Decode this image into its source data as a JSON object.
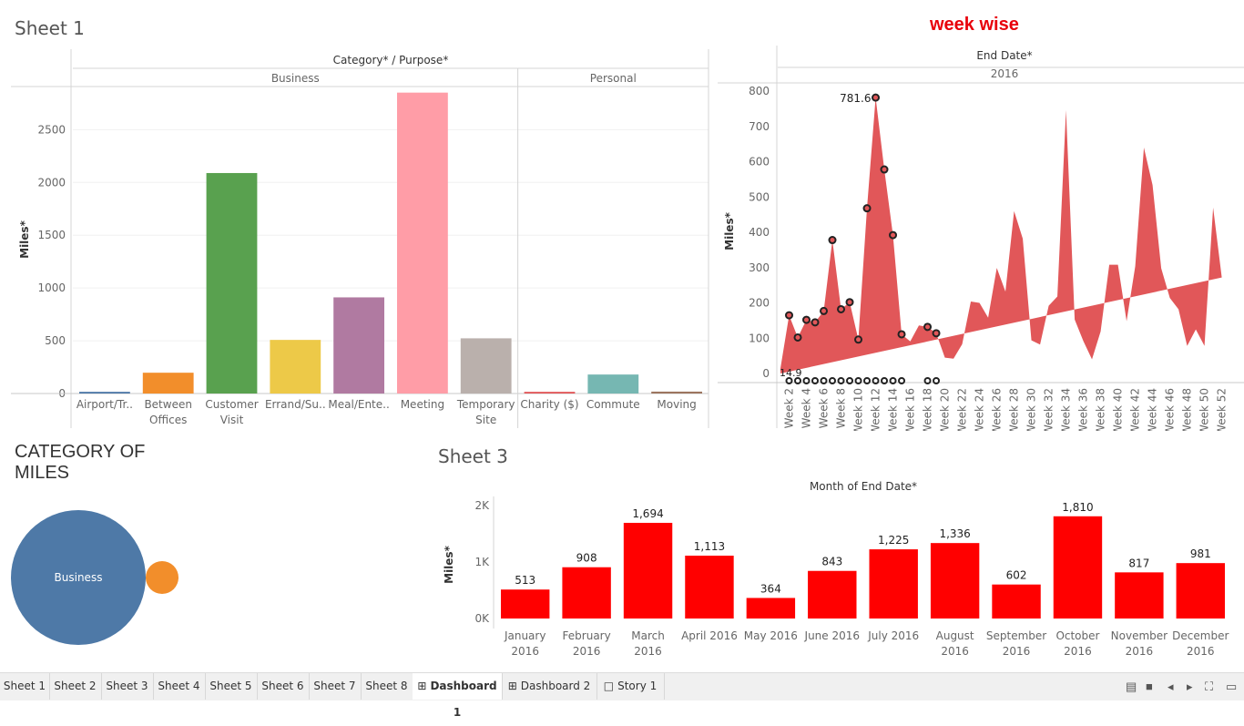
{
  "sheet1": {
    "title": "Sheet 1",
    "chart_data": {
      "type": "bar",
      "header": "Category* / Purpose*",
      "groups": [
        "Business",
        "Personal"
      ],
      "ylabel": "Miles*",
      "ylim": [
        0,
        2900
      ],
      "yticks": [
        0,
        500,
        1000,
        1500,
        2000,
        2500
      ],
      "ytick_labels": [
        "0",
        "500",
        "1000",
        "1500",
        "2000",
        "2500"
      ],
      "categories": [
        {
          "label": [
            "Airport/Tr.."
          ],
          "group": "Business",
          "value": 16,
          "color": "#4e79a7"
        },
        {
          "label": [
            "Between",
            "Offices"
          ],
          "group": "Business",
          "value": 197,
          "color": "#f28e2b"
        },
        {
          "label": [
            "Customer",
            "Visit"
          ],
          "group": "Business",
          "value": 2089,
          "color": "#59a14f"
        },
        {
          "label": [
            "Errand/Su.."
          ],
          "group": "Business",
          "value": 508,
          "color": "#edc948"
        },
        {
          "label": [
            "Meal/Ente.."
          ],
          "group": "Business",
          "value": 911,
          "color": "#b07aa1"
        },
        {
          "label": [
            "Meeting"
          ],
          "group": "Business",
          "value": 2851,
          "color": "#ff9da7"
        },
        {
          "label": [
            "Temporary",
            "Site"
          ],
          "group": "Business",
          "value": 523,
          "color": "#bab0ac"
        },
        {
          "label": [
            "Charity ($)"
          ],
          "group": "Personal",
          "value": 16,
          "color": "#e15759"
        },
        {
          "label": [
            "Commute"
          ],
          "group": "Personal",
          "value": 180,
          "color": "#76b7b2"
        },
        {
          "label": [
            "Moving"
          ],
          "group": "Personal",
          "value": 18,
          "color": "#9c755f"
        }
      ]
    }
  },
  "weekwise": {
    "title": "week wise",
    "chart_data": {
      "type": "area",
      "header": "End Date*",
      "subheader": "2016",
      "ylabel": "Miles*",
      "ylim": [
        0,
        800
      ],
      "yticks": [
        0,
        100,
        200,
        300,
        400,
        500,
        600,
        700,
        800
      ],
      "ytick_labels": [
        "0",
        "100",
        "200",
        "300",
        "400",
        "500",
        "600",
        "700",
        "800"
      ],
      "x_labels": [
        "Week 2",
        "Week 4",
        "Week 6",
        "Week 8",
        "Week 10",
        "Week 12",
        "Week 14",
        "Week 16",
        "Week 18",
        "Week 20",
        "Week 22",
        "Week 24",
        "Week 26",
        "Week 28",
        "Week 30",
        "Week 32",
        "Week 34",
        "Week 36",
        "Week 38",
        "Week 40",
        "Week 42",
        "Week 44",
        "Week 46",
        "Week 48",
        "Week 50",
        "Week 52"
      ],
      "weeks": [
        1,
        2,
        3,
        4,
        5,
        6,
        7,
        8,
        9,
        10,
        11,
        12,
        13,
        14,
        15,
        16,
        17,
        18,
        19,
        20,
        21,
        22,
        23,
        24,
        25,
        26,
        27,
        28,
        29,
        30,
        31,
        32,
        33,
        34,
        35,
        36,
        37,
        38,
        39,
        40,
        41,
        42,
        43,
        44,
        45,
        46,
        47,
        48,
        49,
        50,
        51,
        52,
        53
      ],
      "values": [
        15,
        165,
        102,
        152,
        145,
        177,
        378,
        182,
        202,
        96,
        468,
        781.6,
        578,
        392,
        111,
        91,
        136,
        132,
        114,
        45,
        42,
        83,
        204,
        200,
        158,
        299,
        232,
        460,
        382,
        94,
        82,
        192,
        218,
        746,
        153,
        92,
        40,
        119,
        308,
        308,
        148,
        304,
        640,
        534,
        298,
        214,
        182,
        78,
        125,
        78,
        470,
        272
      ],
      "marked_weeks": [
        2,
        3,
        4,
        5,
        6,
        7,
        8,
        9,
        10,
        11,
        12,
        13,
        14,
        15,
        18,
        19
      ],
      "annotations": [
        {
          "text": "781.6"
        },
        {
          "text": "14.9"
        }
      ],
      "color": "#e15759"
    }
  },
  "category_of_miles": {
    "title": "CATEGORY OF MILES",
    "title_lines": [
      "CATEGORY OF",
      "MILES"
    ],
    "chart_data": {
      "type": "bubble",
      "items": [
        {
          "label": "Business",
          "color": "#4e79a7"
        },
        {
          "label": "",
          "color": "#f28e2b"
        }
      ]
    }
  },
  "sheet3": {
    "title": "Sheet 3",
    "chart_data": {
      "type": "bar",
      "header": "Month of End Date*",
      "ylabel": "Miles*",
      "ylim": [
        0,
        2000
      ],
      "yticks": [
        0,
        1000,
        2000
      ],
      "ytick_labels": [
        "0K",
        "1K",
        "2K"
      ],
      "categories": [
        [
          "January",
          "2016"
        ],
        [
          "February",
          "2016"
        ],
        [
          "March",
          "2016"
        ],
        [
          "April 2016"
        ],
        [
          "May 2016"
        ],
        [
          "June 2016"
        ],
        [
          "July 2016"
        ],
        [
          "August",
          "2016"
        ],
        [
          "September",
          "2016"
        ],
        [
          "October",
          "2016"
        ],
        [
          "November",
          "2016"
        ],
        [
          "December",
          "2016"
        ]
      ],
      "values": [
        513,
        908,
        1694,
        1113,
        364,
        843,
        1225,
        1336,
        602,
        1810,
        817,
        981
      ],
      "value_labels": [
        "513",
        "908",
        "1,694",
        "1,113",
        "364",
        "843",
        "1,225",
        "1,336",
        "602",
        "1,810",
        "817",
        "981"
      ],
      "color": "#ff0000"
    }
  },
  "tabs": [
    {
      "label": "Sheet 1",
      "icon": ""
    },
    {
      "label": "Sheet 2",
      "icon": ""
    },
    {
      "label": "Sheet 3",
      "icon": ""
    },
    {
      "label": "Sheet 4",
      "icon": ""
    },
    {
      "label": "Sheet 5",
      "icon": ""
    },
    {
      "label": "Sheet 6",
      "icon": ""
    },
    {
      "label": "Sheet 7",
      "icon": ""
    },
    {
      "label": "Sheet 8",
      "icon": ""
    },
    {
      "label": "Dashboard 1",
      "icon": "dashboard-icon",
      "active": true
    },
    {
      "label": "Dashboard 2",
      "icon": "dashboard-icon"
    },
    {
      "label": "Story 1",
      "icon": "story-icon"
    }
  ],
  "controls": [
    "sheet-sorter-icon",
    "filmstrip-icon",
    "prev-icon",
    "next-icon",
    "fullscreen-icon",
    "presentation-icon"
  ]
}
